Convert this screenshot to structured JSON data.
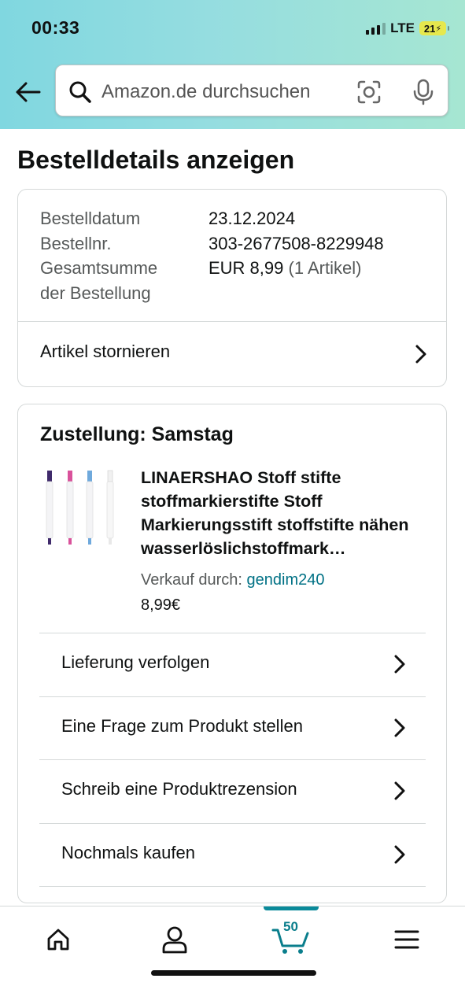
{
  "status_bar": {
    "time": "00:33",
    "network": "LTE",
    "battery": "21"
  },
  "search": {
    "placeholder": "Amazon.de durchsuchen"
  },
  "page": {
    "title": "Bestelldetails anzeigen"
  },
  "order_info": {
    "date_label": "Bestelldatum",
    "date_value": "23.12.2024",
    "number_label": "Bestellnr.",
    "number_value": "303-2677508-8229948",
    "total_label_line1": "Gesamtsumme",
    "total_label_line2": "der Bestellung",
    "total_value": "EUR 8,99",
    "total_items": "(1 Artikel)",
    "cancel_label": "Artikel stornieren"
  },
  "shipment": {
    "heading": "Zustellung: Samstag",
    "product_title": "LINAERSHAO Stoff stifte stoffmarkierstifte Stoff Markierungsstift stoffstifte nähen wasserlöslichstoffmark…",
    "seller_label": "Verkauf durch:",
    "seller_name": "gendim240",
    "price": "8,99€",
    "actions": [
      {
        "label": "Lieferung verfolgen"
      },
      {
        "label": "Eine Frage zum Produkt stellen"
      },
      {
        "label": "Schreib eine Produktrezension"
      },
      {
        "label": "Nochmals kaufen"
      }
    ]
  },
  "bottom_nav": {
    "cart_count": "50"
  },
  "colors": {
    "link": "#007185",
    "accent": "#0a8a9a",
    "header_gradient_start": "#80d7e0",
    "header_gradient_end": "#a6e6d2"
  },
  "icons": [
    "back-arrow-icon",
    "search-icon",
    "camera-lens-icon",
    "microphone-icon",
    "chevron-right-icon",
    "home-icon",
    "account-icon",
    "cart-icon",
    "menu-icon"
  ]
}
